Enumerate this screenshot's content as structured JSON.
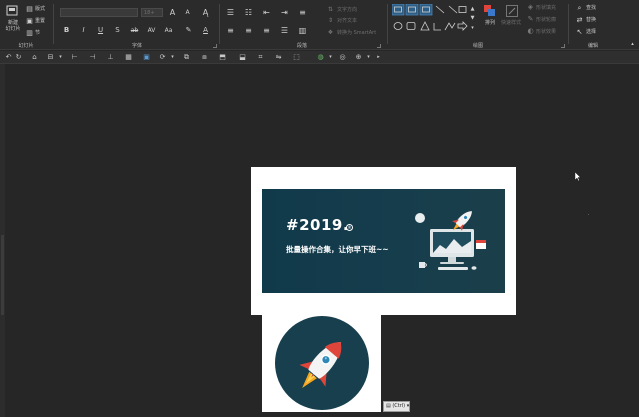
{
  "ribbon": {
    "slides_group": {
      "label": "幻灯片",
      "new_slide": "新建\n幻灯片",
      "new_slide_line1": "新建",
      "new_slide_line2": "幻灯片",
      "layout": "版式",
      "reset": "重置",
      "section": "节"
    },
    "font_group": {
      "label": "字体",
      "font_size_value": "18+"
    },
    "paragraph_group": {
      "label": "段落",
      "text_direction": "文字方向",
      "align_text": "对齐文本",
      "convert_smartart": "转换为 SmartArt"
    },
    "drawing_group": {
      "label": "绘图",
      "arrange": "排列",
      "quick_styles": "快速样式",
      "shape_fill": "形状填充",
      "shape_outline": "形状轮廓",
      "shape_effects": "形状效果"
    },
    "editing_group": {
      "label": "编辑",
      "find": "查找",
      "replace": "替换",
      "select": "选择"
    }
  },
  "slide_banner": {
    "title": "#2019.",
    "registered": "®",
    "subtitle": "批量操作合集，让你早下班~~"
  },
  "paste_options": {
    "label": "(Ctrl)"
  },
  "colors": {
    "ribbon_bg": "#2b2b2b",
    "canvas_bg": "#262626",
    "banner_bg": "#163d4c",
    "rocket_red": "#e0453b",
    "accent_highlight": "#2d5e86"
  }
}
